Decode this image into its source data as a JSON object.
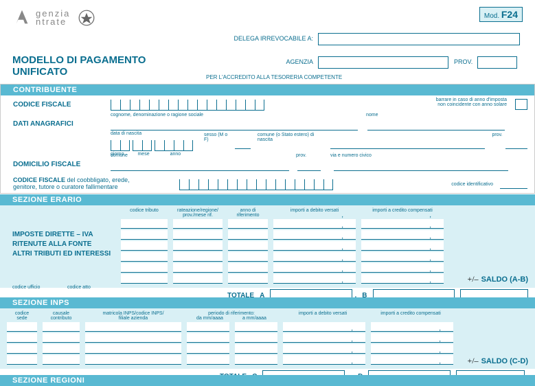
{
  "agency_logo_name": "genzia",
  "agency_logo_name2": "ntrate",
  "mod_label": "Mod.",
  "mod_code": "F24",
  "delega_label": "DELEGA IRREVOCABILE A:",
  "agenzia_label": "AGENZIA",
  "prov_label": "PROV.",
  "accredito": "PER L'ACCREDITO ALLA TESORERIA COMPETENTE",
  "title_l1": "MODELLO DI PAGAMENTO",
  "title_l2": "UNIFICATO",
  "sec_contribuente": "CONTRIBUENTE",
  "codice_fiscale": "CODICE FISCALE",
  "barrare": "barrare in caso di anno d'imposta\nnon coincidente con anno solare",
  "dati_anagrafici": "DATI ANAGRAFICI",
  "cognome": "cognome, denominazione o ragione sociale",
  "nome": "nome",
  "data_nascita": "data di nascita",
  "giorno": "giorno",
  "mese": "mese",
  "anno": "anno",
  "sesso": "sesso (M o F)",
  "comune_nascita": "comune (o Stato estero) di nascita",
  "prov": "prov.",
  "domicilio_fiscale": "DOMICILIO FISCALE",
  "comune": "comune",
  "via": "via e numero civico",
  "cf_coobbligato_1": "CODICE FISCALE",
  "cf_coobbligato_2": " del coobbligato, erede,",
  "cf_coobbligato_3": "genitore, tutore o curatore fallimentare",
  "codice_identificativo": "codice identificativo",
  "sec_erario": "SEZIONE ERARIO",
  "codice_tributo": "codice tributo",
  "rateazione": "rateazione/regione/\nprov./mese rif.",
  "anno_rif": "anno di\nriferimento",
  "importi_debito": "importi a debito versati",
  "importi_credito": "importi a credito compensati",
  "imposte_1": "IMPOSTE DIRETTE – IVA",
  "imposte_2": "RITENUTE ALLA FONTE",
  "imposte_3": "ALTRI TRIBUTI ED INTERESSI",
  "codice_ufficio": "codice ufficio",
  "codice_atto": "codice atto",
  "totale": "TOTALE",
  "letter_a": "A",
  "letter_b": "B",
  "letter_c": "C",
  "letter_d": "D",
  "saldo_ab": "SALDO  (A-B)",
  "saldo_cd": "SALDO  (C-D)",
  "sec_inps": "SEZIONE INPS",
  "codice_sede": "codice\nsede",
  "causale_contributo": "causale\ncontributo",
  "matricola": "matricola INPS/codice INPS/\nfiliale azienda",
  "periodo_rif": "periodo di riferimento:",
  "da_mm": "da mm/aaaa",
  "a_mm": "a mm/aaaa",
  "sec_regioni": "SEZIONE REGIONI"
}
